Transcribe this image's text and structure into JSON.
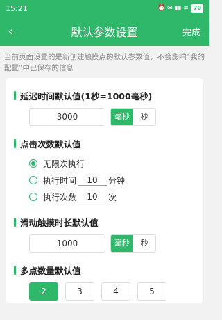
{
  "status_bar": {
    "time": "15:21",
    "icons": "⏰ ✉ ▮▮ ≋",
    "battery": "70"
  },
  "nav": {
    "back": "‹",
    "title": "默认参数设置",
    "done": "完成"
  },
  "notice": "当前页面设置的是新创建触摸点的默认参数值，不会影响“我的配置”中已保存的信息",
  "delay": {
    "title": "延迟时间默认值(1秒=1000毫秒)",
    "value": "3000",
    "unit_ms": "毫秒",
    "unit_s": "秒",
    "selected": "毫秒"
  },
  "clicks": {
    "title": "点击次数默认值",
    "opt_unlimited": "无限次执行",
    "opt_time_label": "执行时间",
    "opt_time_value": "10",
    "opt_time_unit": "分钟",
    "opt_count_label": "执行次数",
    "opt_count_value": "10",
    "opt_count_unit": "次",
    "selected": "无限次执行"
  },
  "slide": {
    "title": "滑动触摸时长默认值",
    "value": "1000",
    "unit_ms": "毫秒",
    "unit_s": "秒",
    "selected": "毫秒"
  },
  "multi": {
    "title": "多点数量默认值",
    "options": [
      "2",
      "3",
      "4",
      "5"
    ],
    "selected": "2"
  },
  "colors": {
    "accent": "#2fb86a"
  }
}
